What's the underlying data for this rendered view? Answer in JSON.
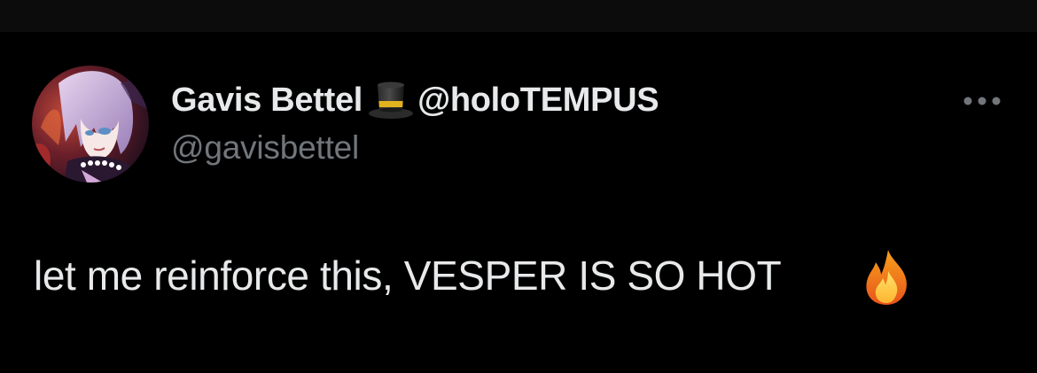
{
  "tweet": {
    "author": {
      "display_name": "Gavis Bettel",
      "name_emoji": "top-hat-emoji",
      "name_suffix": "@holoTEMPUS",
      "handle": "@gavisbettel"
    },
    "text": "let me reinforce this, VESPER IS SO HOT",
    "text_emoji": "fire-emoji",
    "more_icon": "more-dots-icon"
  },
  "colors": {
    "background": "#000000",
    "primary_text": "#e7e9ea",
    "secondary_text": "#71767b"
  }
}
